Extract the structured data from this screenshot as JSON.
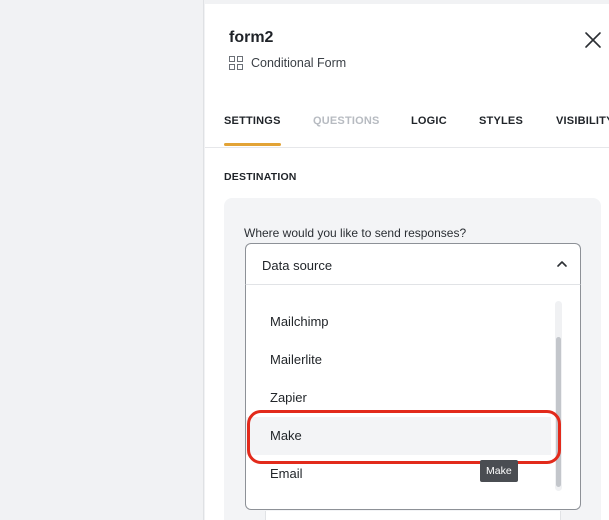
{
  "panel": {
    "title": "form2",
    "subtitle": "Conditional Form"
  },
  "tabs": [
    {
      "label": "SETTINGS",
      "active": true
    },
    {
      "label": "QUESTIONS",
      "disabled": true
    },
    {
      "label": "LOGIC"
    },
    {
      "label": "STYLES"
    },
    {
      "label": "VISIBILITY"
    }
  ],
  "destination": {
    "section_label": "DESTINATION",
    "question": "Where would you like to send responses?",
    "dropdown_value": "Data source",
    "options": [
      "Mailchimp",
      "Mailerlite",
      "Zapier",
      "Make",
      "Email"
    ],
    "hovered_option": "Make",
    "tooltip": "Make"
  },
  "colors": {
    "accent_underline": "#e2a336",
    "highlight_ring": "#e22a1b",
    "tooltip_bg": "#4a4d52"
  },
  "icons": {
    "close": "close-icon",
    "form_type": "grid-icon",
    "dropdown": "chevron-up-icon"
  }
}
